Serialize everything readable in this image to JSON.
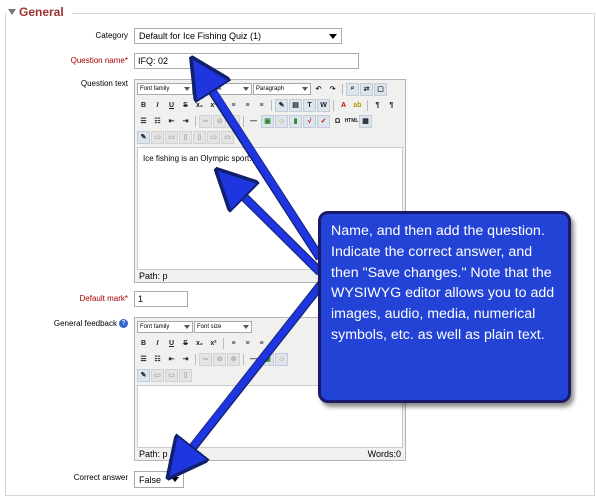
{
  "section": {
    "legend": "General"
  },
  "category": {
    "label": "Category",
    "value": "Default for Ice Fishing Quiz (1)"
  },
  "question_name": {
    "label": "Question name",
    "required_mark": "*",
    "value": "IFQ: 02"
  },
  "question_text": {
    "label": "Question text",
    "toolbar": {
      "font_family": "Font family",
      "font_size": "Font size",
      "format": "Paragraph"
    },
    "content": "Ice fishing is an Olympic sport.",
    "path": "Path: p"
  },
  "default_mark": {
    "label": "Default mark",
    "required_mark": "*",
    "value": "1"
  },
  "general_feedback": {
    "label": "General feedback",
    "help_icon": "question-mark-icon",
    "toolbar": {
      "font_family": "Font family",
      "font_size": "Font size"
    },
    "path": "Path: p",
    "words": "Words:0"
  },
  "correct_answer": {
    "label": "Correct answer",
    "value": "False"
  },
  "callout": {
    "text": "Name, and then add the question. Indicate the correct answer, and then \"Save changes.\" Note that the WYSIWYG editor allows you to add images, audio, media, numerical symbols, etc. as well as plain text."
  },
  "colors": {
    "legend": "#993333",
    "required": "#aa0000",
    "callout_fill": "#2243d6",
    "arrow": "#1f35e0"
  }
}
